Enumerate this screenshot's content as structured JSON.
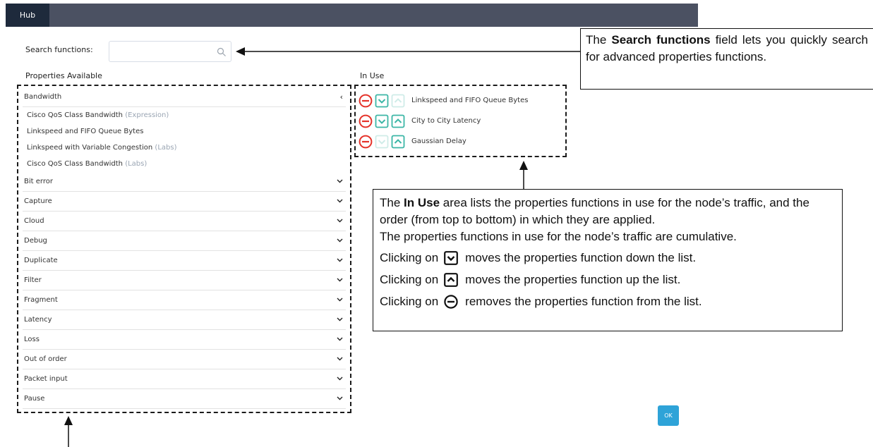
{
  "header": {
    "tab_label": "Hub"
  },
  "search": {
    "label": "Search functions:",
    "value": "",
    "placeholder": ""
  },
  "properties": {
    "title": "Properties Available",
    "expanded_category": "Bandwidth",
    "bandwidth_items": [
      {
        "name": "Cisco QoS Class Bandwidth",
        "tag": "(Expression)"
      },
      {
        "name": "Linkspeed and FIFO Queue Bytes",
        "tag": ""
      },
      {
        "name": "Linkspeed with Variable Congestion",
        "tag": "(Labs)"
      },
      {
        "name": "Cisco QoS Class Bandwidth",
        "tag": "(Labs)"
      }
    ],
    "collapsed_categories": [
      "Bit error",
      "Capture",
      "Cloud",
      "Debug",
      "Duplicate",
      "Filter",
      "Fragment",
      "Latency",
      "Loss",
      "Out of order",
      "Packet input",
      "Pause"
    ]
  },
  "in_use": {
    "title": "In Use",
    "items": [
      {
        "name": "Linkspeed and FIFO Queue Bytes",
        "down_enabled": true,
        "up_enabled": false
      },
      {
        "name": "City to City Latency",
        "down_enabled": true,
        "up_enabled": true
      },
      {
        "name": "Gaussian Delay",
        "down_enabled": false,
        "up_enabled": true
      }
    ]
  },
  "callouts": {
    "search": {
      "prefix": "The",
      "bold": "Search functions",
      "suffix": "field lets you quickly search for advanced properties functions."
    },
    "in_use": {
      "intro_prefix": "The",
      "intro_bold": "In Use",
      "intro_suffix": "area lists the properties functions in use for the node’s traffic, and the order (from top to bottom) in which they are applied.",
      "cumulative": "The properties functions in use for the node’s traffic are cumulative.",
      "clicking_on": "Clicking on",
      "down_text": "moves the properties function down the list.",
      "up_text": "moves the properties function up the list.",
      "remove_text": "removes the properties function from the list."
    }
  },
  "buttons": {
    "ok_label": "OK"
  },
  "colors": {
    "topbar": "#4b5162",
    "hub_tab": "#1e2a3c",
    "remove_red": "#e5332a",
    "arrow_teal": "#3cb6a6",
    "ok_blue": "#2ea3d8"
  },
  "icons": {
    "search": "search-icon",
    "collapse": "chevron-left-icon",
    "expand": "chevron-down-icon",
    "remove": "minus-circle-icon",
    "down": "arrow-down-box-icon",
    "up": "arrow-up-box-icon"
  }
}
